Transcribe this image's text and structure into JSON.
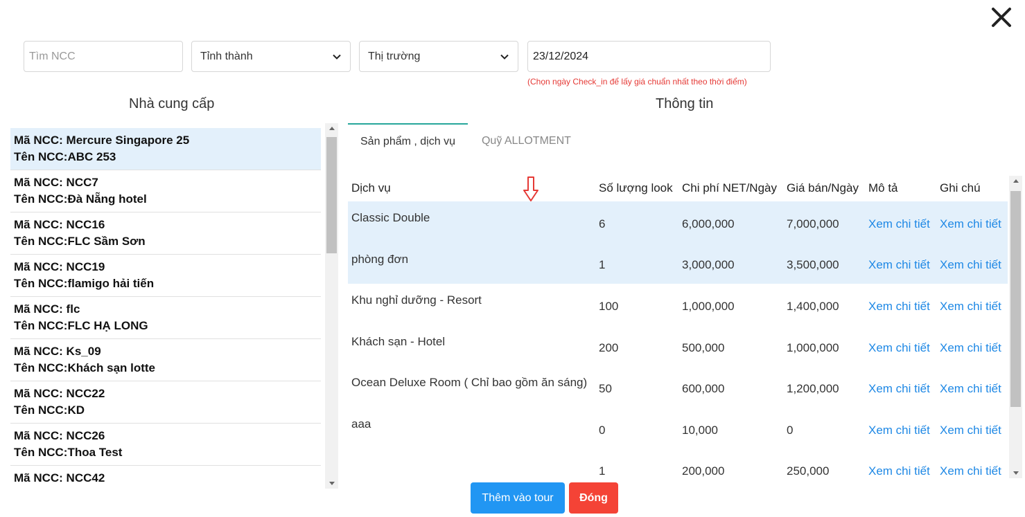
{
  "filters": {
    "search_placeholder": "Tìm NCC",
    "province_label": "Tỉnh thành",
    "market_label": "Thị trường",
    "date_value": "23/12/2024",
    "date_hint": "(Chọn ngày Check_in để lấy giá chuẩn nhất theo thời điểm)"
  },
  "panels": {
    "left_title": "Nhà cung cấp",
    "right_title": "Thông tin"
  },
  "suppliers": [
    {
      "code": "Mã NCC: Mercure Singapore 25",
      "name": "Tên NCC:ABC 253"
    },
    {
      "code": "Mã NCC: NCC7",
      "name": "Tên NCC:Đà Nẵng hotel"
    },
    {
      "code": "Mã NCC: NCC16",
      "name": "Tên NCC:FLC Sầm Sơn"
    },
    {
      "code": "Mã NCC: NCC19",
      "name": "Tên NCC:flamigo hải tiến"
    },
    {
      "code": "Mã NCC: flc",
      "name": "Tên NCC:FLC HẠ LONG"
    },
    {
      "code": "Mã NCC: Ks_09",
      "name": "Tên NCC:Khách sạn lotte"
    },
    {
      "code": "Mã NCC: NCC22",
      "name": "Tên NCC:KD"
    },
    {
      "code": "Mã NCC: NCC26",
      "name": "Tên NCC:Thoa Test"
    },
    {
      "code": "Mã NCC: NCC42",
      "name": ""
    }
  ],
  "tabs": {
    "products": "Sản phẩm , dịch vụ",
    "allotment": "Quỹ ALLOTMENT"
  },
  "table": {
    "headers": [
      "Dịch vụ",
      "Số lượng look",
      "Chi phí NET/Ngày",
      "Giá bán/Ngày",
      "Mô tả",
      "Ghi chú"
    ],
    "rows": [
      {
        "service": "Classic Double",
        "qty": "6",
        "net": "6,000,000",
        "price": "7,000,000",
        "desc": "Xem chi tiết",
        "note": "Xem chi tiết"
      },
      {
        "service": "phòng đơn",
        "qty": "1",
        "net": "3,000,000",
        "price": "3,500,000",
        "desc": "Xem chi tiết",
        "note": "Xem chi tiết"
      },
      {
        "service": "Khu nghỉ dưỡng - Resort",
        "qty": "100",
        "net": "1,000,000",
        "price": "1,400,000",
        "desc": "Xem chi tiết",
        "note": "Xem chi tiết"
      },
      {
        "service": "Khách sạn - Hotel",
        "qty": "200",
        "net": "500,000",
        "price": "1,000,000",
        "desc": "Xem chi tiết",
        "note": "Xem chi tiết"
      },
      {
        "service": "Ocean Deluxe Room ( Chỉ bao gồm ăn sáng)",
        "qty": "50",
        "net": "600,000",
        "price": "1,200,000",
        "desc": "Xem chi tiết",
        "note": "Xem chi tiết"
      },
      {
        "service": "aaa",
        "qty": "0",
        "net": "10,000",
        "price": "0",
        "desc": "Xem chi tiết",
        "note": "Xem chi tiết"
      },
      {
        "service": "",
        "qty": "1",
        "net": "200,000",
        "price": "250,000",
        "desc": "Xem chi tiết",
        "note": "Xem chi tiết"
      }
    ]
  },
  "buttons": {
    "add_to_tour": "Thêm vào tour",
    "close": "Đóng"
  },
  "colors": {
    "primary": "#2196f3",
    "danger": "#f44336",
    "link": "#1e88e5",
    "highlight": "#e3f0fb",
    "tab_accent": "#26a69a",
    "hint": "#e53935"
  }
}
